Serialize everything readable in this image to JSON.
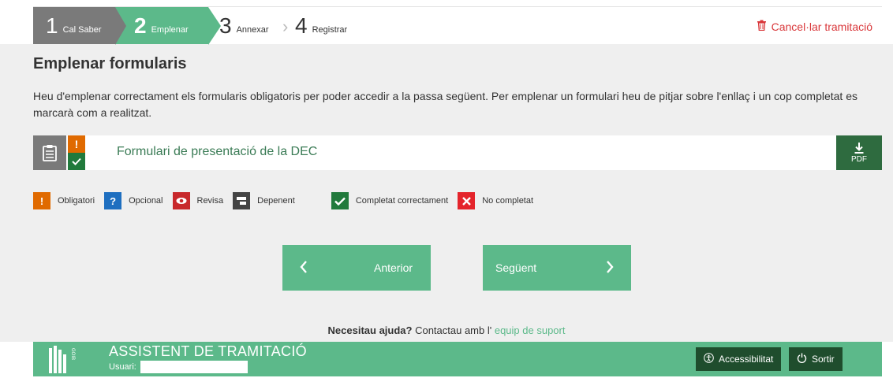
{
  "steps": [
    {
      "number": "1",
      "label": "Cal Saber"
    },
    {
      "number": "2",
      "label": "Emplenar"
    },
    {
      "number": "3",
      "label": "Annexar"
    },
    {
      "number": "4",
      "label": "Registrar"
    }
  ],
  "cancel_label": "Cancel·lar tramitació",
  "page": {
    "title": "Emplenar formularis",
    "description": "Heu d'emplenar correctament els formularis obligatoris per poder accedir a la passa següent. Per emplenar un formulari heu de pitjar sobre l'enllaç i un cop completat es marcarà com a realitzat."
  },
  "form": {
    "link_text": "Formulari de presentació de la DEC",
    "pdf_label": "PDF",
    "badges": {
      "top": "!",
      "bottom": "✓"
    }
  },
  "legend": [
    {
      "symbol": "!",
      "label": "Obligatori",
      "color": "#e06a00"
    },
    {
      "symbol": "?",
      "label": "Opcional",
      "color": "#1e6fc0"
    },
    {
      "symbol": "◉",
      "label": "Revisa",
      "color": "#c8282b"
    },
    {
      "symbol": "▭",
      "label": "Depenent",
      "color": "#444444"
    },
    {
      "symbol": "✓",
      "label": "Completat correctament",
      "color": "#217a3c"
    },
    {
      "symbol": "✕",
      "label": "No completat",
      "color": "#e4242b"
    }
  ],
  "nav": {
    "previous": "Anterior",
    "next": "Següent"
  },
  "help": {
    "question": "Necesitau ajuda?",
    "text": " Contactau amb l' ",
    "link": "equip de suport"
  },
  "footer": {
    "app_title": "ASSISTENT DE TRAMITACIÓ",
    "user_label": "Usuari:",
    "user_value": "",
    "accessibility": "Accessibilitat",
    "logout": "Sortir",
    "logo_vertical_text": "GOIB"
  },
  "colors": {
    "accent": "#5cb98a",
    "step_done": "#7a7a7a",
    "dark_green": "#2e6b3f",
    "cancel": "#d9373a"
  }
}
